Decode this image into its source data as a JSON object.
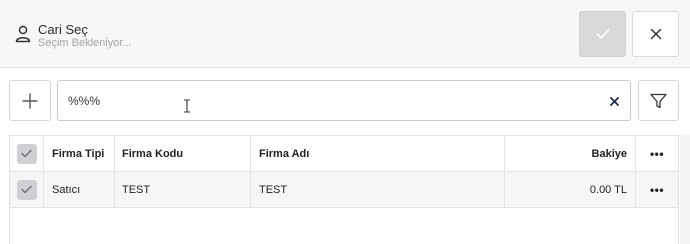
{
  "header": {
    "title": "Cari Seç",
    "subtitle": "Seçim Bekleniyor..."
  },
  "toolbar": {
    "search_value": "%%%"
  },
  "table": {
    "columns": [
      "Firma Tipi",
      "Firma Kodu",
      "Firma Adı",
      "Bakiye"
    ],
    "rows": [
      {
        "firma_tipi": "Satıcı",
        "firma_kodu": "TEST",
        "firma_adi": "TEST",
        "bakiye": "0.00 TL"
      }
    ],
    "more_glyph": "•••"
  },
  "colors": {
    "header_bg": "#f7f7f8",
    "confirm_bg": "#d9d9db",
    "checkbox_bg": "#cfcfd4",
    "row_bg": "#f6f6f7"
  },
  "icons": {
    "user": "user-icon",
    "confirm": "check-icon",
    "close": "close-icon",
    "add": "plus-icon",
    "clear": "clear-x-icon",
    "filter": "filter-icon"
  }
}
